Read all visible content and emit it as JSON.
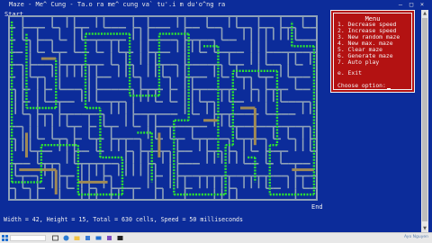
{
  "window": {
    "title": "Maze - Me^ Cung - Ta.o ra me^ cung va` tu'.i m du'o^ng ra",
    "minimize": "–",
    "maximize": "□",
    "close": "×"
  },
  "maze": {
    "start_label": "Start",
    "end_label": "End",
    "colors": {
      "background": "#0c2c9a",
      "wall": "#8fa2b8",
      "path": "#2ee82e",
      "visited": "#a08a55"
    }
  },
  "menu": {
    "title": "Menu",
    "items": [
      "1. Decrease speed",
      "2. Increase speed",
      "3. New random maze",
      "4. New max. maze",
      "5. Clear maze",
      "6. Generate maze",
      "7. Auto play",
      "e. Exit"
    ],
    "prompt": "Choose option:"
  },
  "status_line": "Width = 42, Height = 15, Total = 630 cells, Speed = 50 milliseconds",
  "taskbar": {
    "watermark": "Ayo Nguyen"
  }
}
